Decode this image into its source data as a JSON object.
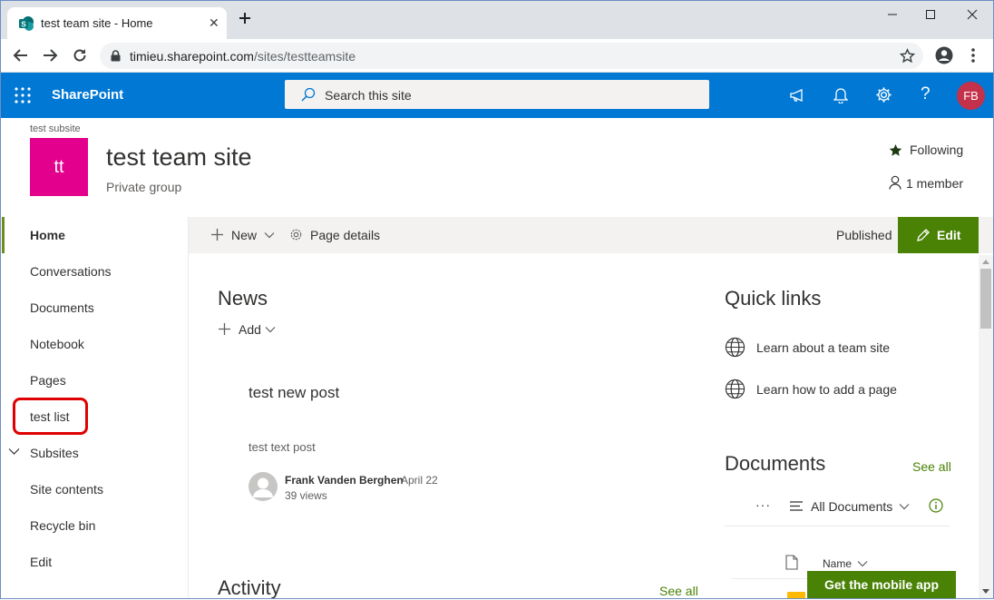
{
  "browser": {
    "tab_title": "test team site - Home",
    "tab_close": "✕",
    "url_host": "timieu.sharepoint.com",
    "url_path": "/sites/testteamsite"
  },
  "suitebar": {
    "brand": "SharePoint",
    "search_placeholder": "Search this site",
    "avatar_initials": "FB",
    "color": "#0078d4"
  },
  "site": {
    "subsite_label": "test subsite",
    "logo_text": "tt",
    "title": "test team site",
    "subtitle": "Private group",
    "following": "Following",
    "members": "1 member"
  },
  "nav": {
    "items": [
      {
        "label": "Home"
      },
      {
        "label": "Conversations"
      },
      {
        "label": "Documents"
      },
      {
        "label": "Notebook"
      },
      {
        "label": "Pages"
      },
      {
        "label": "test list"
      },
      {
        "label": "Subsites"
      },
      {
        "label": "Site contents"
      },
      {
        "label": "Recycle bin"
      },
      {
        "label": "Edit"
      }
    ]
  },
  "commandbar": {
    "new_label": "New",
    "page_details_label": "Page details",
    "status": "Published",
    "edit_label": "Edit"
  },
  "news": {
    "title": "News",
    "add_label": "Add",
    "post_title": "test new post",
    "post_text": "test text post",
    "author": "Frank Vanden Berghen",
    "date": "April 22",
    "views": "39 views"
  },
  "quicklinks": {
    "title": "Quick links",
    "links": [
      {
        "label": "Learn about a team site"
      },
      {
        "label": "Learn how to add a page"
      }
    ]
  },
  "documents": {
    "title": "Documents",
    "see_all": "See all",
    "more": "···",
    "view_label": "All Documents",
    "name_col": "Name"
  },
  "activity": {
    "title": "Activity",
    "see_all": "See all"
  },
  "mobile_app_label": "Get the mobile app"
}
